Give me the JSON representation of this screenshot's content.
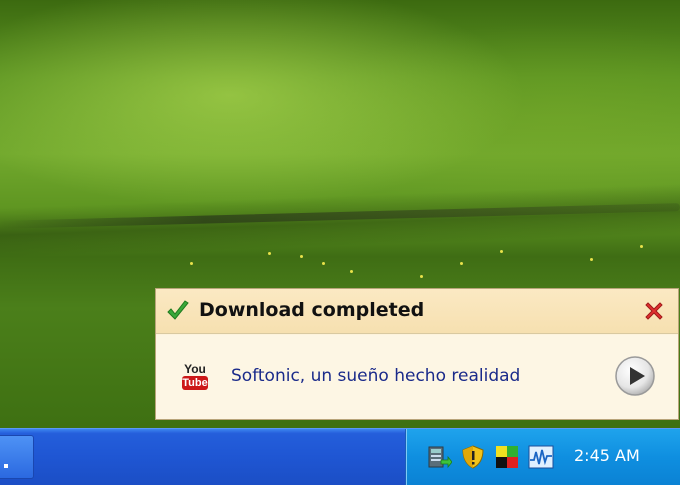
{
  "notification": {
    "title": "Download completed",
    "item_source_icon_text_top": "You",
    "item_source_icon_text_bottom": "Tube",
    "file_name": "Softonic, un sueño hecho realidad",
    "icons": {
      "status": "checkmark-icon",
      "close": "close-icon",
      "source": "youtube-icon",
      "action": "play-icon"
    }
  },
  "taskbar": {
    "tray_icons": [
      "download-manager-icon",
      "security-shield-icon",
      "color-squares-icon",
      "network-activity-icon"
    ],
    "clock": "2:45 AM"
  },
  "colors": {
    "popup_header": "#fbe9c3",
    "popup_body": "#fdf6e4",
    "taskbar": "#245edb",
    "tray": "#0f8fe0",
    "close_red": "#e03030",
    "check_green": "#3aa83a"
  }
}
